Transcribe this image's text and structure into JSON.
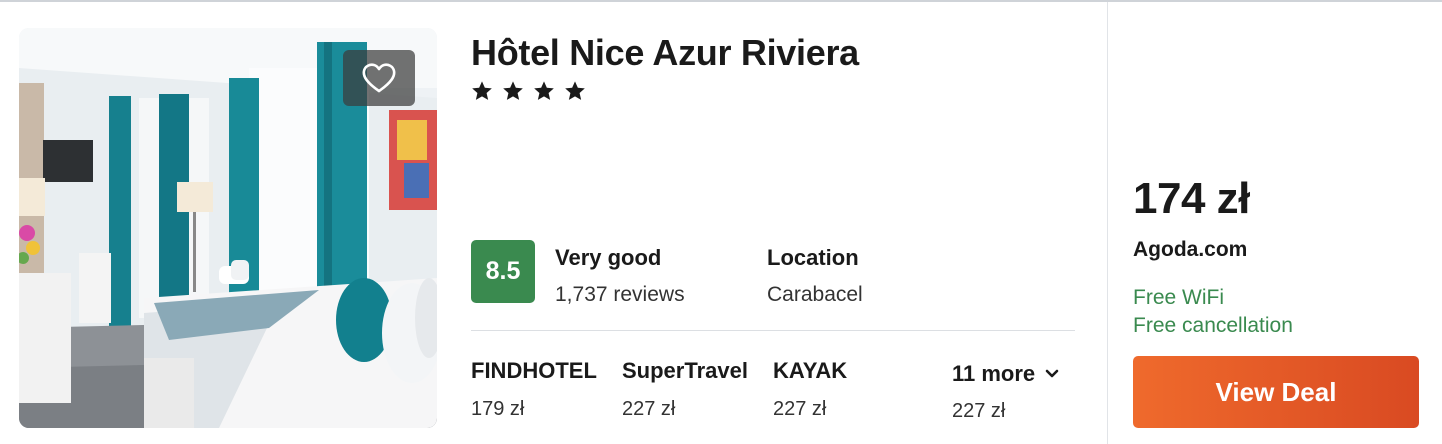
{
  "hotel": {
    "name": "Hôtel Nice Azur Riviera",
    "stars": 4
  },
  "rating": {
    "score": "8.5",
    "label": "Very good",
    "reviews": "1,737 reviews",
    "badge_color": "#3a8a4f"
  },
  "location": {
    "label": "Location",
    "value": "Carabacel"
  },
  "providers": [
    {
      "name": "FINDHOTEL",
      "price": "179 zł"
    },
    {
      "name": "SuperTravel",
      "price": "227 zł"
    },
    {
      "name": "KAYAK",
      "price": "227 zł"
    }
  ],
  "more": {
    "label": "11 more",
    "price": "227 zł",
    "icon": "chevron-down-icon"
  },
  "deal": {
    "price": "174 zł",
    "site": "Agoda.com",
    "features": [
      "Free WiFi",
      "Free cancellation"
    ],
    "feature_color": "#3a8a4f",
    "button_label": "View Deal",
    "button_color": "#e85d2a"
  },
  "icons": {
    "favorite": "heart-icon",
    "star": "star-icon"
  }
}
